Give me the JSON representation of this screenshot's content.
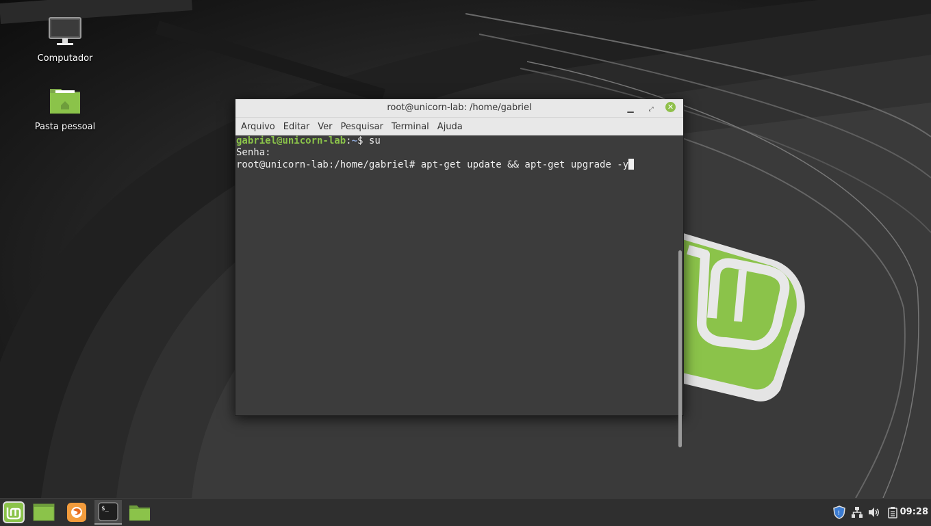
{
  "desktop": {
    "icons": [
      {
        "label": "Computador"
      },
      {
        "label": "Pasta pessoal"
      }
    ]
  },
  "terminal": {
    "title": "root@unicorn-lab: /home/gabriel",
    "menu": [
      "Arquivo",
      "Editar",
      "Ver",
      "Pesquisar",
      "Terminal",
      "Ajuda"
    ],
    "lines": {
      "l1_user": "gabriel@unicorn-lab",
      "l1_sep": ":",
      "l1_path": "~",
      "l1_cmd": "$ su",
      "l2": "Senha:",
      "l3": "root@unicorn-lab:/home/gabriel# apt-get update && apt-get upgrade -y"
    }
  },
  "taskbar": {
    "clock": "09:28",
    "items": [
      "menu-button",
      "show-desktop",
      "firefox",
      "terminal",
      "files"
    ]
  },
  "colors": {
    "mint_green": "#8bc34a",
    "titlebar": "#e8e8e8",
    "terminal_bg": "#3c3c3c",
    "panel": "#2f2f2f"
  }
}
